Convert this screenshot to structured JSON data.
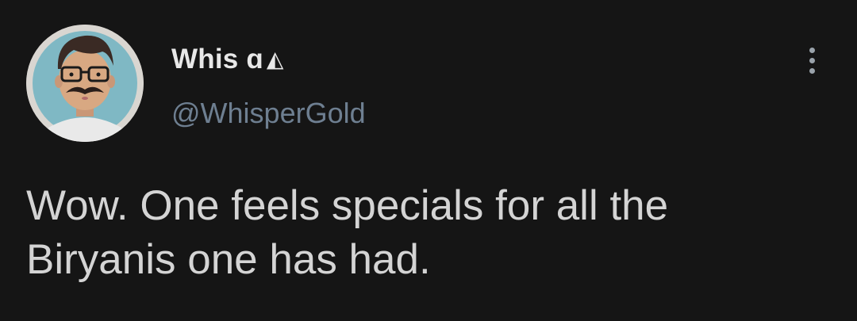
{
  "author": {
    "display_name": "Whis ɑ",
    "name_suffix_symbol": "◭",
    "handle": "@WhisperGold",
    "avatar_icon": "cartoon-man-avatar-icon"
  },
  "menu": {
    "icon": "more-vertical-icon"
  },
  "tweet": {
    "line1": "Wow. One feels specials for all the",
    "line2": "Biryanis one has had."
  },
  "colors": {
    "background": "#151515",
    "name": "#e8e8e8",
    "handle": "#6e7f91",
    "text": "#d4d4d4"
  }
}
